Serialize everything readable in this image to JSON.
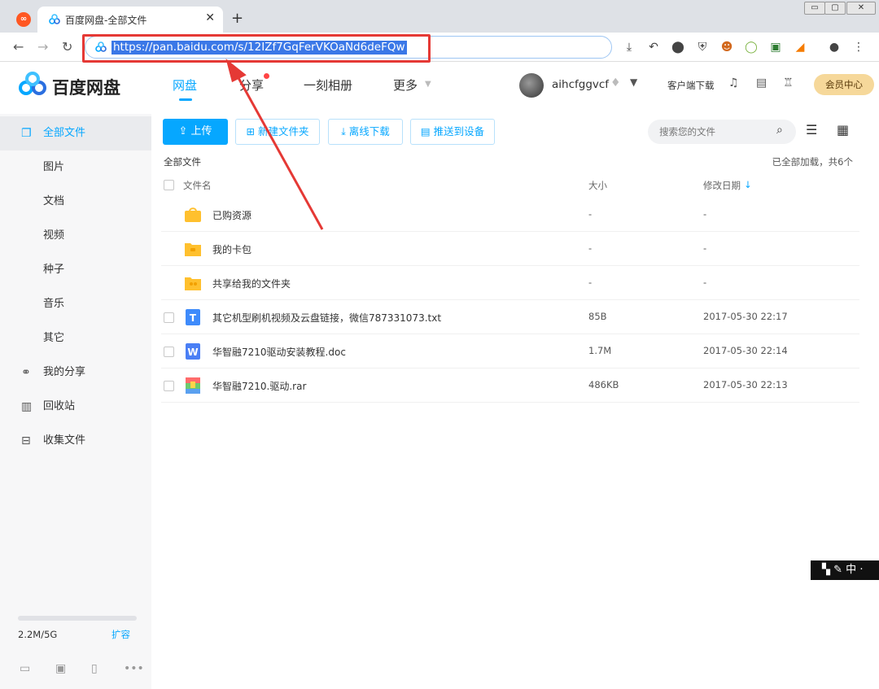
{
  "browser": {
    "tab_title": "百度网盘-全部文件",
    "url": "https://pan.baidu.com/s/12IZf7GqFerVKOaNd6deFQw",
    "window_buttons": [
      "▭",
      "▢",
      "✕"
    ]
  },
  "header": {
    "brand": "百度网盘",
    "nav": [
      "网盘",
      "分享",
      "一刻相册",
      "更多"
    ],
    "username": "aihcfggvcf",
    "client_download": "客户端下载",
    "vip": "会员中心"
  },
  "sidebar": {
    "items": [
      {
        "label": "全部文件",
        "icon": "file-icon",
        "active": true
      },
      {
        "label": "图片"
      },
      {
        "label": "文档"
      },
      {
        "label": "视频"
      },
      {
        "label": "种子"
      },
      {
        "label": "音乐"
      },
      {
        "label": "其它"
      },
      {
        "label": "我的分享",
        "icon": "share-icon"
      },
      {
        "label": "回收站",
        "icon": "recycle-icon"
      },
      {
        "label": "收集文件",
        "icon": "collect-icon"
      }
    ],
    "quota": "2.2M/5G",
    "quota_fraction": 0.0004,
    "expand": "扩容"
  },
  "toolbar": {
    "upload": "上传",
    "new_folder": "新建文件夹",
    "offline_download": "离线下载",
    "push_device": "推送到设备",
    "search_placeholder": "搜索您的文件"
  },
  "listing": {
    "breadcrumb": "全部文件",
    "loaded_info": "已全部加载，共6个",
    "columns": {
      "name": "文件名",
      "size": "大小",
      "date": "修改日期"
    },
    "rows": [
      {
        "name": "已购资源",
        "size": "-",
        "date": "-",
        "type": "folder-bag",
        "checkbox": false
      },
      {
        "name": "我的卡包",
        "size": "-",
        "date": "-",
        "type": "folder-card",
        "checkbox": false
      },
      {
        "name": "共享给我的文件夹",
        "size": "-",
        "date": "-",
        "type": "folder-shared",
        "checkbox": false
      },
      {
        "name": "其它机型刷机视频及云盘链接，微信787331073.txt",
        "size": "85B",
        "date": "2017-05-30 22:17",
        "type": "txt",
        "checkbox": true
      },
      {
        "name": "华智融7210驱动安装教程.doc",
        "size": "1.7M",
        "date": "2017-05-30 22:14",
        "type": "doc",
        "checkbox": true
      },
      {
        "name": "华智融7210.驱动.rar",
        "size": "486KB",
        "date": "2017-05-30 22:13",
        "type": "rar",
        "checkbox": true
      }
    ]
  },
  "ime": "中"
}
